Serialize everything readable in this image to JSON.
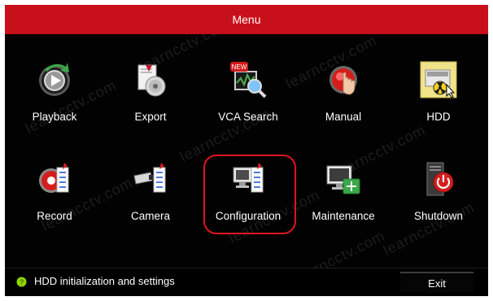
{
  "window": {
    "title": "Menu"
  },
  "watermark": "learncctv.com",
  "menu": {
    "items": [
      {
        "label": "Playback"
      },
      {
        "label": "Export"
      },
      {
        "label": "VCA Search",
        "badge": "NEW"
      },
      {
        "label": "Manual"
      },
      {
        "label": "HDD"
      },
      {
        "label": "Record"
      },
      {
        "label": "Camera"
      },
      {
        "label": "Configuration",
        "selected": true
      },
      {
        "label": "Maintenance"
      },
      {
        "label": "Shutdown"
      }
    ]
  },
  "status": {
    "icon": "help-icon",
    "text": "HDD initialization and settings"
  },
  "footer": {
    "exit_label": "Exit"
  },
  "colors": {
    "title_bar": "#c8101b",
    "highlight": "#e0141e",
    "background": "#020202"
  }
}
